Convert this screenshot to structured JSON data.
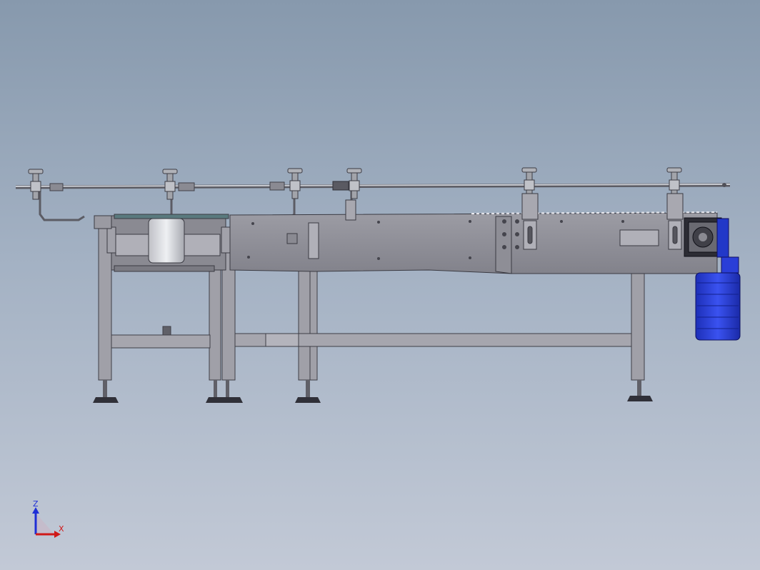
{
  "triad": {
    "z_label": "Z",
    "x_label": "X",
    "z_color": "#1f2fd6",
    "x_color": "#d01818"
  },
  "colors": {
    "frame": "#9a9aa2",
    "frame_dark": "#505058",
    "motor": "#2a3ed8",
    "rail": "#c4c6cc"
  }
}
